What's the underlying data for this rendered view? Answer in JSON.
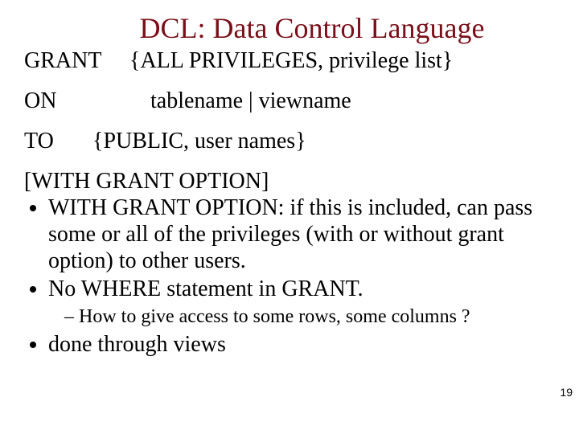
{
  "title": "DCL: Data Control Language",
  "syntax": {
    "grant_kw": "GRANT",
    "grant_args": "{ALL PRIVILEGES, privilege list}",
    "on_kw": "ON",
    "on_args": "tablename | viewname",
    "to_kw": "TO",
    "to_args": "{PUBLIC, user names}",
    "with_line": "[WITH GRANT OPTION]"
  },
  "bullets": {
    "b1": "WITH GRANT OPTION: if this is included, can pass some or all of the privileges (with or without grant option) to other users.",
    "b2": "No WHERE statement in GRANT.",
    "b2_sub": "How to give access to some rows, some columns ?",
    "b3": "done through views"
  },
  "page_number": "19"
}
